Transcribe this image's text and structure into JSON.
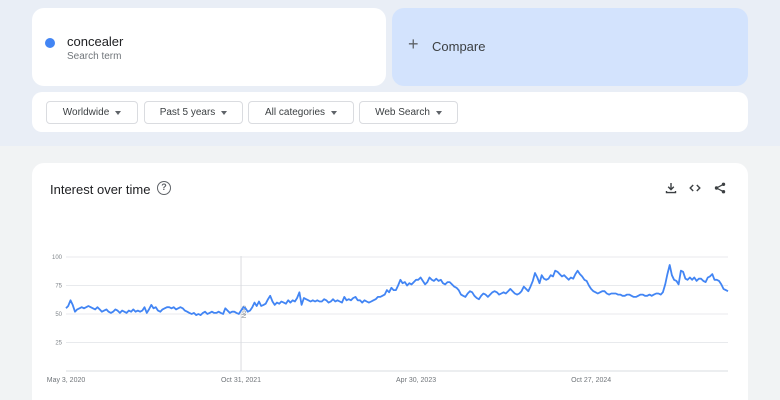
{
  "search": {
    "term": "concealer",
    "term_sub": "Search term",
    "term_color": "#4285f4",
    "compare_plus": "+",
    "compare_label": "Compare"
  },
  "filters": [
    {
      "label": "Worldwide"
    },
    {
      "label": "Past 5 years"
    },
    {
      "label": "All categories"
    },
    {
      "label": "Web Search"
    }
  ],
  "card": {
    "title": "Interest over time",
    "help_icon": "?",
    "tools": [
      "download-icon",
      "embed-icon",
      "share-icon"
    ]
  },
  "chart_data": {
    "type": "line",
    "title": "Interest over time",
    "xlabel": "",
    "ylabel": "",
    "ylim": [
      0,
      100
    ],
    "yticks": [
      25,
      50,
      75,
      100
    ],
    "grid": true,
    "series_color": "#4285f4",
    "x_ticks": [
      "May 3, 2020",
      "Oct 31, 2021",
      "Apr 30, 2023",
      "Oct 27, 2024"
    ],
    "note_label": "Note",
    "note_week": 78,
    "series": [
      {
        "values": [
          55,
          57,
          62,
          58,
          52,
          54,
          55,
          56,
          55,
          56,
          57,
          56,
          55,
          54,
          56,
          54,
          52,
          53,
          54,
          52,
          51,
          52,
          54,
          53,
          51,
          53,
          52,
          51,
          53,
          52,
          54,
          52,
          53,
          52,
          53,
          56,
          51,
          54,
          58,
          55,
          56,
          53,
          52,
          54,
          55,
          56,
          56,
          55,
          56,
          54,
          55,
          56,
          55,
          53,
          52,
          51,
          50,
          51,
          49,
          50,
          49,
          51,
          52,
          50,
          51,
          52,
          51,
          51,
          52,
          51,
          50,
          55,
          53,
          51,
          52,
          52,
          51,
          50,
          53,
          56,
          55,
          52,
          53,
          56,
          60,
          57,
          61,
          57,
          58,
          59,
          63,
          66,
          61,
          58,
          60,
          59,
          61,
          60,
          59,
          62,
          60,
          62,
          61,
          64,
          69,
          58,
          64,
          63,
          62,
          61,
          62,
          61,
          62,
          61,
          61,
          63,
          62,
          60,
          61,
          63,
          61,
          62,
          61,
          60,
          65,
          62,
          63,
          62,
          64,
          65,
          62,
          62,
          60,
          62,
          61,
          60,
          61,
          62,
          63,
          65,
          65,
          66,
          67,
          71,
          69,
          73,
          71,
          71,
          75,
          80,
          77,
          78,
          75,
          77,
          76,
          78,
          80,
          80,
          82,
          79,
          76,
          78,
          82,
          80,
          79,
          81,
          79,
          80,
          77,
          76,
          78,
          78,
          76,
          74,
          73,
          71,
          67,
          66,
          65,
          68,
          70,
          69,
          66,
          64,
          63,
          66,
          68,
          67,
          65,
          67,
          69,
          70,
          69,
          67,
          68,
          69,
          68,
          70,
          72,
          70,
          68,
          67,
          68,
          70,
          74,
          72,
          70,
          74,
          79,
          86,
          82,
          77,
          84,
          81,
          80,
          81,
          84,
          83,
          88,
          87,
          85,
          83,
          84,
          82,
          80,
          82,
          81,
          85,
          88,
          85,
          83,
          80,
          79,
          75,
          72,
          70,
          69,
          68,
          69,
          70,
          70,
          68,
          67,
          68,
          68,
          68,
          67,
          67,
          66,
          66,
          67,
          67,
          66,
          65,
          65,
          66,
          67,
          67,
          66,
          66,
          67,
          66,
          67,
          68,
          68,
          67,
          69,
          76,
          85,
          93,
          84,
          80,
          79,
          76,
          88,
          87,
          81,
          80,
          82,
          80,
          82,
          79,
          81,
          81,
          79,
          78,
          82,
          83,
          85,
          80,
          80,
          79,
          76,
          72,
          71,
          70
        ]
      }
    ]
  }
}
